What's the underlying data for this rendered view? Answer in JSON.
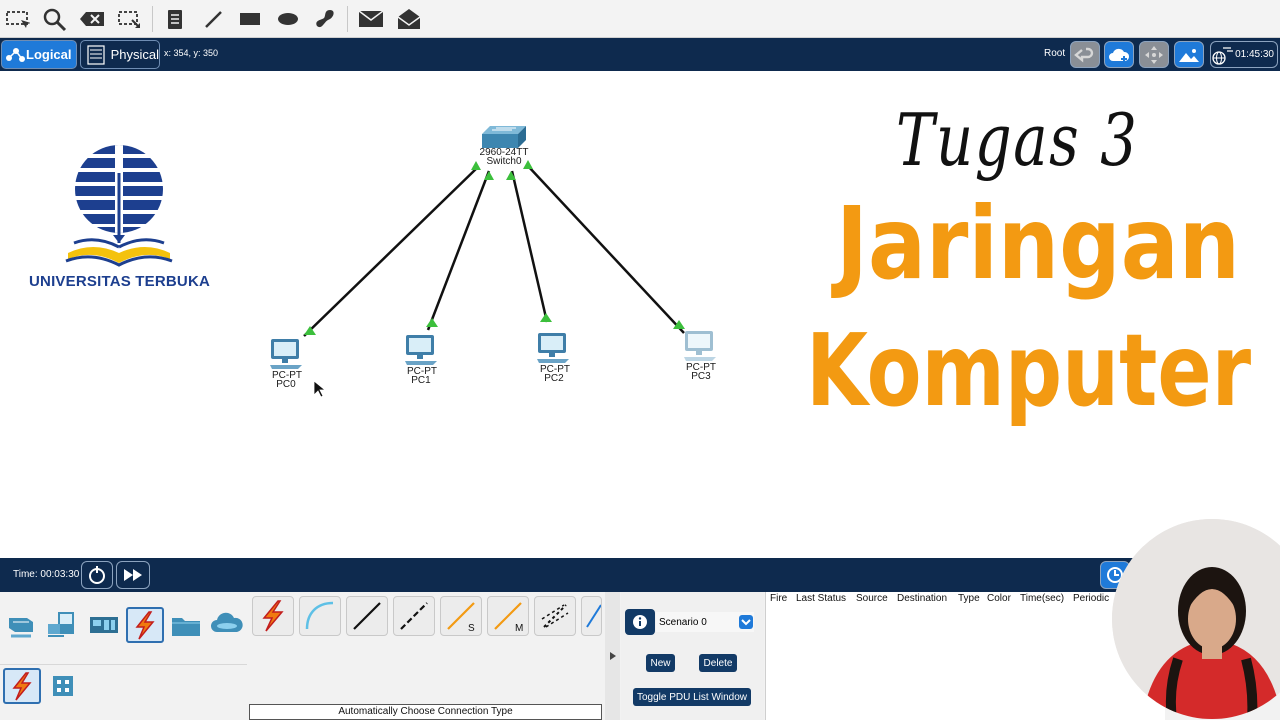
{
  "workspace": {
    "logical_label": "Logical",
    "physical_label": "Physical",
    "coordinates": "x: 354, y: 350",
    "root_label": "Root",
    "clock": "01:45:30"
  },
  "devices": {
    "switch": {
      "model": "2960-24TT",
      "name": "Switch0"
    },
    "pcs": [
      {
        "model": "PC-PT",
        "name": "PC0"
      },
      {
        "model": "PC-PT",
        "name": "PC1"
      },
      {
        "model": "PC-PT",
        "name": "PC2"
      },
      {
        "model": "PC-PT",
        "name": "PC3"
      }
    ]
  },
  "overlay": {
    "line1": "Tugas 3",
    "line2": "Jaringan",
    "line3": "Komputer",
    "university": "UNIVERSITAS TERBUKA",
    "title_color": "#f39a12",
    "logo_blue": "#1d3f8f",
    "logo_yellow": "#f4c20d"
  },
  "realtime": {
    "time": "Time: 00:03:30"
  },
  "bottom": {
    "connection_type": "Automatically Choose Connection Type",
    "scenario": "Scenario 0",
    "new_label": "New",
    "delete_label": "Delete",
    "toggle_label": "Toggle PDU List Window",
    "pdu_columns": [
      "Fire",
      "Last Status",
      "Source",
      "Destination",
      "Type",
      "Color",
      "Time(sec)",
      "Periodic"
    ],
    "conn_letters": {
      "serial": "S",
      "multiuser": "M"
    }
  }
}
